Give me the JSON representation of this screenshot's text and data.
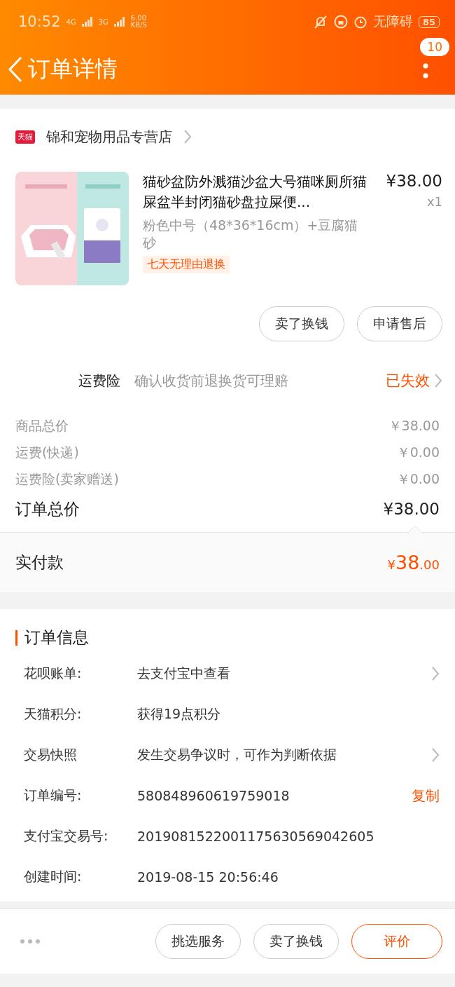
{
  "status_bar": {
    "time": "10:52",
    "networks": [
      "4G",
      "3G"
    ],
    "speed": "6.00",
    "speed_unit": "KB/S",
    "accessibility": "无障碍",
    "battery": "85"
  },
  "header": {
    "title": "订单详情",
    "badge": "10"
  },
  "shop": {
    "logo": "天猫",
    "name": "锦和宠物用品专营店"
  },
  "product": {
    "title": "猫砂盆防外溅猫沙盆大号猫咪厕所猫屎盆半封闭猫砂盘拉屎便...",
    "price": "¥38.00",
    "quantity": "x1",
    "spec": "粉色中号（48*36*16cm）+豆腐猫砂",
    "tag": "七天无理由退换"
  },
  "product_actions": [
    "卖了换钱",
    "申请售后"
  ],
  "insurance": {
    "label": "运费险",
    "description": "确认收货前退换货可理赔",
    "status": "已失效"
  },
  "price_rows": [
    {
      "label": "商品总价",
      "value": "￥38.00"
    },
    {
      "label": "运费(快递)",
      "value": "￥0.00"
    },
    {
      "label": "运费险(卖家赠送)",
      "value": "￥0.00"
    }
  ],
  "order_total": {
    "label": "订单总价",
    "value": "¥38.00"
  },
  "paid": {
    "label": "实付款",
    "currency": "¥",
    "amount": "38",
    "decimals": ".00"
  },
  "order_info": {
    "title": "订单信息",
    "rows": [
      {
        "label": "花呗账单:",
        "value": "去支付宝中查看",
        "kind": "link"
      },
      {
        "label": "天猫积分:",
        "value": "获得19点积分",
        "kind": "plain"
      },
      {
        "label": "交易快照",
        "value": "发生交易争议时，可作为判断依据",
        "kind": "link"
      },
      {
        "label": "订单编号:",
        "value": "580848960619759018",
        "kind": "copy",
        "action": "复制"
      },
      {
        "label": "支付宝交易号:",
        "value": "2019081522001175630569042605",
        "kind": "plain"
      },
      {
        "label": "创建时间:",
        "value": "2019-08-15 20:56:46",
        "kind": "plain"
      }
    ]
  },
  "bottom_bar": {
    "buttons": [
      {
        "label": "挑选服务",
        "kind": "outline"
      },
      {
        "label": "卖了换钱",
        "kind": "outline"
      },
      {
        "label": "评价",
        "kind": "primary"
      }
    ]
  }
}
